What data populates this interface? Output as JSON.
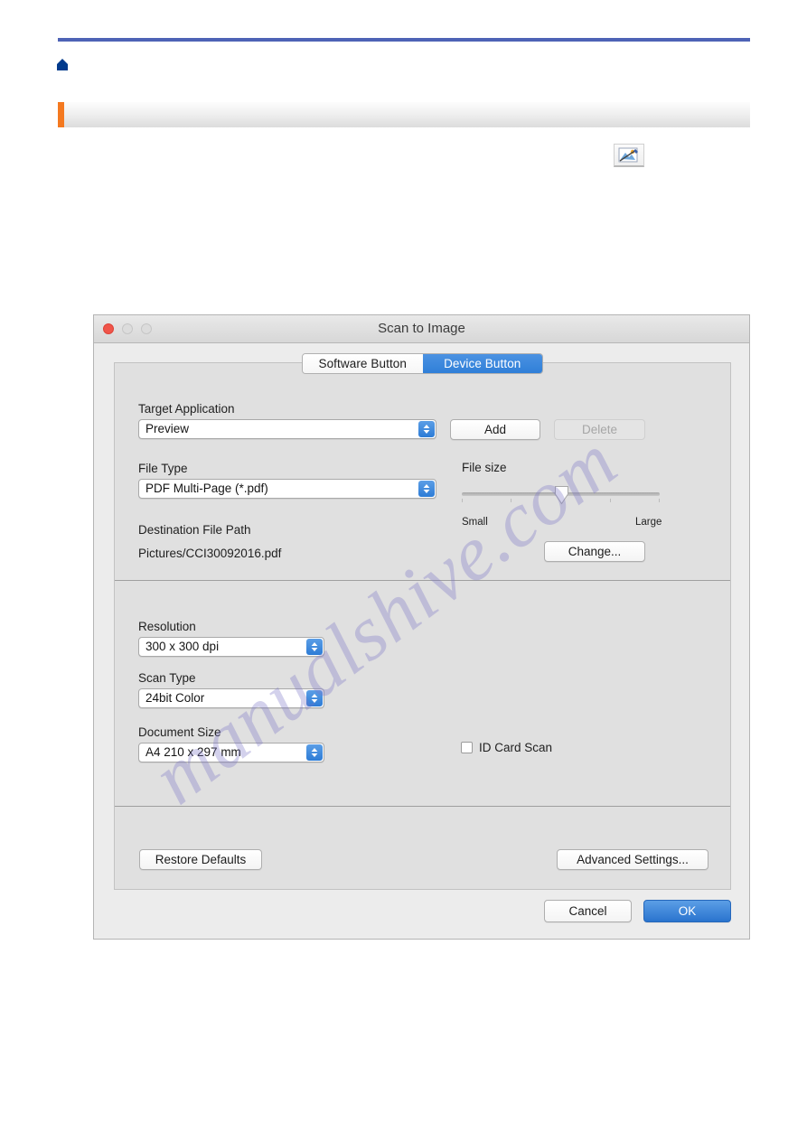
{
  "page": {
    "home_icon": "home-icon",
    "app_icon": "scan-to-image-app-icon",
    "watermark_text": "manualshive.com"
  },
  "colors": {
    "rule_blue": "#4e63b6",
    "accent_orange": "#f47920",
    "tab_active_blue": "#2f7fd8",
    "primary_button_blue": "#2a74ce",
    "close_red": "#f0554a"
  },
  "dialog": {
    "title": "Scan to Image",
    "traffic_lights": [
      "close",
      "minimize",
      "maximize"
    ],
    "tabs": [
      {
        "label": "Software Button",
        "active": false
      },
      {
        "label": "Device Button",
        "active": true
      }
    ],
    "fields": {
      "target_application": {
        "label": "Target Application",
        "value": "Preview"
      },
      "file_type": {
        "label": "File Type",
        "value": "PDF Multi-Page (*.pdf)"
      },
      "destination_file_path": {
        "label": "Destination File Path",
        "value": "Pictures/CCI30092016.pdf"
      },
      "resolution": {
        "label": "Resolution",
        "value": "300 x 300 dpi"
      },
      "scan_type": {
        "label": "Scan Type",
        "value": "24bit Color"
      },
      "document_size": {
        "label": "Document Size",
        "value": "A4 210 x 297 mm"
      },
      "id_card_scan": {
        "label": "ID Card Scan",
        "checked": false
      }
    },
    "file_size": {
      "label": "File size",
      "min_label": "Small",
      "max_label": "Large",
      "position_percent": 50
    },
    "buttons": {
      "add": "Add",
      "delete": "Delete",
      "change": "Change...",
      "restore_defaults": "Restore Defaults",
      "advanced_settings": "Advanced Settings...",
      "cancel": "Cancel",
      "ok": "OK"
    }
  }
}
